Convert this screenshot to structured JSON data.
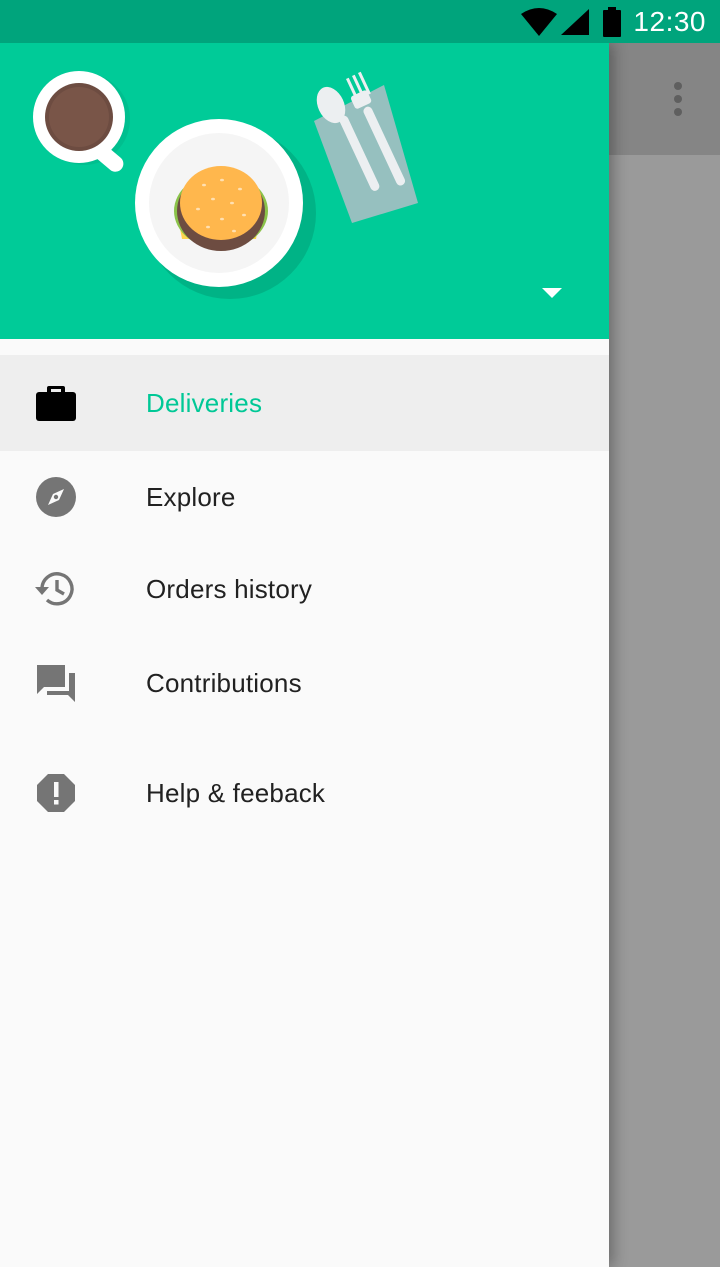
{
  "status_bar": {
    "time": "12:30",
    "icons": [
      "wifi-icon",
      "cell-signal-icon",
      "battery-icon"
    ]
  },
  "app_toolbar": {
    "icons": [
      "overflow-menu-icon"
    ]
  },
  "drawer": {
    "header": {
      "illustration": [
        "coffee-cup-icon",
        "burger-plate-icon",
        "spoon-icon",
        "fork-icon",
        "napkin-icon"
      ],
      "dropdown_icon": "arrow-drop-down-icon",
      "background_color": "#00cb98"
    },
    "items": [
      {
        "label": "Deliveries",
        "icon": "briefcase-icon",
        "active": true
      },
      {
        "label": "Explore",
        "icon": "compass-icon",
        "active": false
      },
      {
        "label": "Orders history",
        "icon": "history-icon",
        "active": false
      },
      {
        "label": "Contributions",
        "icon": "forum-icon",
        "active": false
      },
      {
        "label": "Help & feeback",
        "icon": "alert-octagon-icon",
        "active": false
      }
    ],
    "accent_color": "#00c896"
  }
}
